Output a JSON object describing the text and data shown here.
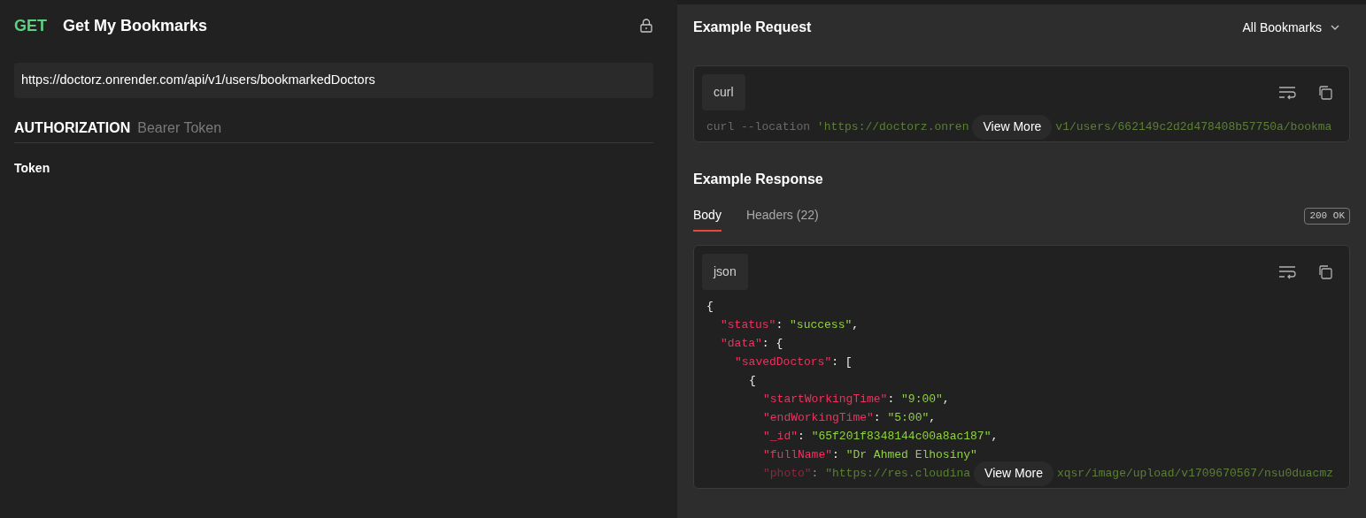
{
  "request": {
    "method": "GET",
    "name": "Get My Bookmarks",
    "locked": true,
    "url": "https://doctorz.onrender.com/api/v1/users/bookmarkedDoctors",
    "auth_label": "AUTHORIZATION",
    "auth_type": "Bearer Token",
    "token_label": "Token"
  },
  "example_request": {
    "title": "Example Request",
    "dropdown": "All Bookmarks",
    "language": "curl",
    "lines": [
      {
        "faded": true,
        "tokens": [
          {
            "kind": "plain",
            "text": "curl --location "
          },
          {
            "kind": "string",
            "text": "'https://doctorz.onren"
          },
          {
            "kind": "more",
            "text": "View More"
          },
          {
            "kind": "string",
            "text": "v1/users/662149c2d2d478408b57750a/bookma"
          }
        ]
      }
    ]
  },
  "example_response": {
    "title": "Example Response",
    "tabs": [
      {
        "label": "Body",
        "selected": true
      },
      {
        "label": "Headers (22)",
        "selected": false
      }
    ],
    "status": "200 OK",
    "language": "json",
    "lines": [
      {
        "faded": false,
        "tokens": [
          {
            "kind": "punct",
            "text": "{"
          }
        ],
        "children": [
          {
            "faded": false,
            "tokens": [
              {
                "kind": "key",
                "text": "\"status\""
              },
              {
                "kind": "punct",
                "text": ": "
              },
              {
                "kind": "string",
                "text": "\"success\""
              },
              {
                "kind": "punct",
                "text": ","
              }
            ]
          },
          {
            "faded": false,
            "tokens": [
              {
                "kind": "key",
                "text": "\"data\""
              },
              {
                "kind": "punct",
                "text": ": {"
              }
            ],
            "children": [
              {
                "faded": false,
                "tokens": [
                  {
                    "kind": "key",
                    "text": "\"savedDoctors\""
                  },
                  {
                    "kind": "punct",
                    "text": ": ["
                  }
                ],
                "children": [
                  {
                    "faded": false,
                    "tokens": [
                      {
                        "kind": "punct",
                        "text": "{"
                      }
                    ],
                    "children": [
                      {
                        "faded": false,
                        "tokens": [
                          {
                            "kind": "key",
                            "text": "\"startWorkingTime\""
                          },
                          {
                            "kind": "punct",
                            "text": ": "
                          },
                          {
                            "kind": "string",
                            "text": "\"9:00\""
                          },
                          {
                            "kind": "punct",
                            "text": ","
                          }
                        ]
                      },
                      {
                        "faded": false,
                        "tokens": [
                          {
                            "kind": "key",
                            "text": "\"endWorkingTime\""
                          },
                          {
                            "kind": "punct",
                            "text": ": "
                          },
                          {
                            "kind": "string",
                            "text": "\"5:00\""
                          },
                          {
                            "kind": "punct",
                            "text": ","
                          }
                        ]
                      },
                      {
                        "faded": false,
                        "tokens": [
                          {
                            "kind": "key",
                            "text": "\"_id\""
                          },
                          {
                            "kind": "punct",
                            "text": ": "
                          },
                          {
                            "kind": "string",
                            "text": "\"65f201f8348144c00a8ac187\""
                          },
                          {
                            "kind": "punct",
                            "text": ","
                          }
                        ]
                      },
                      {
                        "faded": false,
                        "tokens": [
                          {
                            "kind": "key",
                            "text": "\"fullName\""
                          },
                          {
                            "kind": "punct",
                            "text": ": "
                          },
                          {
                            "kind": "string",
                            "text": "\"Dr Ahmed Elhosiny\""
                          }
                        ]
                      },
                      {
                        "faded": true,
                        "tokens": [
                          {
                            "kind": "key",
                            "text": "\"photo\""
                          },
                          {
                            "kind": "punct",
                            "text": ": "
                          },
                          {
                            "kind": "string",
                            "text": "\"https://res.cloudina"
                          },
                          {
                            "kind": "more",
                            "text": "View More"
                          },
                          {
                            "kind": "string",
                            "text": "xqsr/image/upload/v1709670567/nsu0duacmz"
                          }
                        ]
                      }
                    ]
                  }
                ]
              }
            ]
          }
        ]
      }
    ]
  }
}
